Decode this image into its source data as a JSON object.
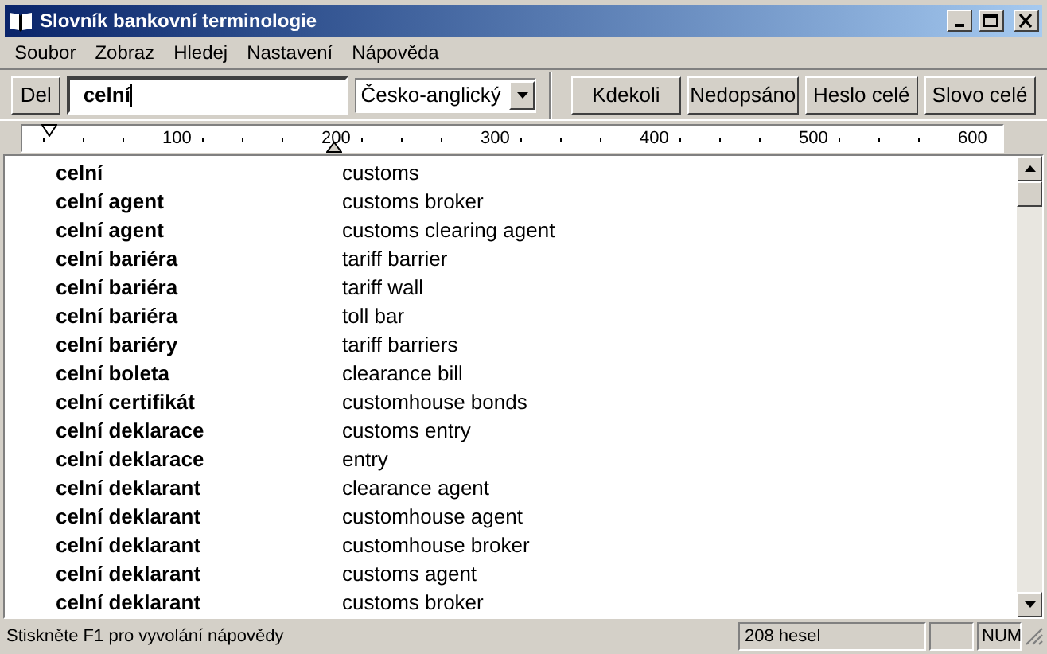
{
  "window": {
    "title": "Slovník bankovní terminologie"
  },
  "menu": [
    "Soubor",
    "Zobraz",
    "Hledej",
    "Nastavení",
    "Nápověda"
  ],
  "toolbar": {
    "del_button": "Del",
    "search": {
      "value": "celní"
    },
    "language": "Česko-anglický",
    "buttons": [
      "Kdekoli",
      "Nedopsáno",
      "Heslo celé",
      "Slovo celé"
    ]
  },
  "ruler": {
    "ticks": [
      "100",
      "200",
      "300",
      "400",
      "500",
      "600"
    ]
  },
  "entries": [
    {
      "term": "celní",
      "translation": "customs"
    },
    {
      "term": "celní agent",
      "translation": "customs broker"
    },
    {
      "term": "celní agent",
      "translation": "customs clearing agent"
    },
    {
      "term": "celní bariéra",
      "translation": "tariff barrier"
    },
    {
      "term": "celní bariéra",
      "translation": "tariff wall"
    },
    {
      "term": "celní bariéra",
      "translation": "toll bar"
    },
    {
      "term": "celní bariéry",
      "translation": "tariff barriers"
    },
    {
      "term": "celní boleta",
      "translation": "clearance bill"
    },
    {
      "term": "celní certifikát",
      "translation": "customhouse bonds"
    },
    {
      "term": "celní deklarace",
      "translation": "customs entry"
    },
    {
      "term": "celní deklarace",
      "translation": "entry"
    },
    {
      "term": "celní deklarant",
      "translation": "clearance agent"
    },
    {
      "term": "celní deklarant",
      "translation": "customhouse agent"
    },
    {
      "term": "celní deklarant",
      "translation": "customhouse broker"
    },
    {
      "term": "celní deklarant",
      "translation": "customs agent"
    },
    {
      "term": "celní deklarant",
      "translation": "customs broker"
    }
  ],
  "status_bar": {
    "hint": "Stiskněte F1 pro vyvolání nápovědy",
    "count": "208 hesel",
    "num": "NUM"
  }
}
